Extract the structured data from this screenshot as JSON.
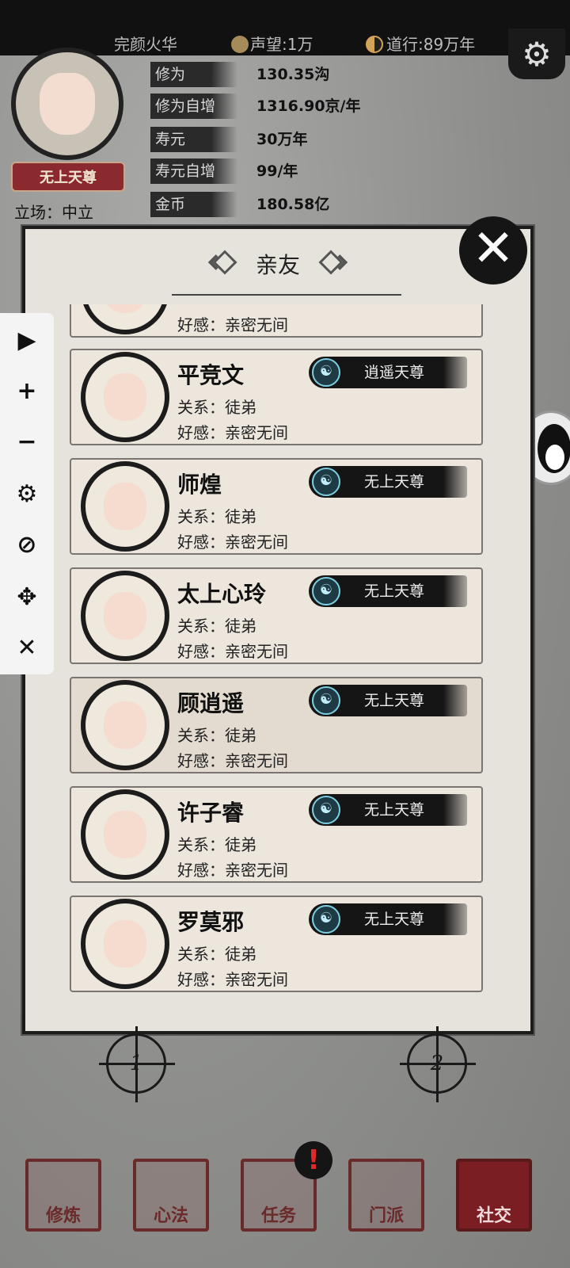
{
  "header": {
    "player_name": "完颜火华",
    "prestige": "声望:1万",
    "dao_practice": "道行:89万年",
    "rank_badge": "无上天尊",
    "stance": "立场：中立"
  },
  "stats": [
    {
      "label": "修为",
      "value": "130.35沟"
    },
    {
      "label": "修为自增",
      "value": "1316.90京/年"
    },
    {
      "label": "寿元",
      "value": "30万年"
    },
    {
      "label": "寿元自增",
      "value": "99/年"
    },
    {
      "label": "金币",
      "value": "180.58亿"
    }
  ],
  "modal": {
    "title": "亲友",
    "close_icon": "close-icon",
    "partial_card": {
      "affinity": "好感：亲密无间"
    },
    "friends": [
      {
        "name": "平竞文",
        "relation": "关系：徒弟",
        "affinity": "好感：亲密无间",
        "rank": "逍遥天尊"
      },
      {
        "name": "师煌",
        "relation": "关系：徒弟",
        "affinity": "好感：亲密无间",
        "rank": "无上天尊"
      },
      {
        "name": "太上心玲",
        "relation": "关系：徒弟",
        "affinity": "好感：亲密无间",
        "rank": "无上天尊"
      },
      {
        "name": "顾逍遥",
        "relation": "关系：徒弟",
        "affinity": "好感：亲密无间",
        "rank": "无上天尊"
      },
      {
        "name": "许子睿",
        "relation": "关系：徒弟",
        "affinity": "好感：亲密无间",
        "rank": "无上天尊"
      },
      {
        "name": "罗莫邪",
        "relation": "关系：徒弟",
        "affinity": "好感：亲密无间",
        "rank": "无上天尊"
      }
    ]
  },
  "floating_toolbar": {
    "items": [
      "play-icon",
      "plus-icon",
      "minus-icon",
      "gear-icon",
      "eye-off-icon",
      "move-icon",
      "close-icon"
    ],
    "glyphs": [
      "▶",
      "+",
      "−",
      "⚙",
      "⊘",
      "✥",
      "✕"
    ]
  },
  "page_markers": [
    "1",
    "2"
  ],
  "bottom_nav": {
    "tabs": [
      "修炼",
      "心法",
      "任务",
      "门派",
      "社交"
    ],
    "active": "社交",
    "alert": "!"
  },
  "colors": {
    "badge_red": "#8a2a2e",
    "nav_red": "#7a1e24",
    "ink_black": "#151515",
    "paper": "#e6e3dc"
  }
}
